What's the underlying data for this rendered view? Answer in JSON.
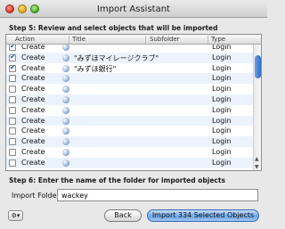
{
  "window": {
    "title": "Import Assistant"
  },
  "step5": {
    "label": "Step 5: Review and select objects that will be imported"
  },
  "table": {
    "columns": {
      "action": "Action",
      "title": "Title",
      "subfolder": "Subfolder",
      "type": "Type"
    },
    "rows": [
      {
        "checked": true,
        "action": "Create",
        "title": "",
        "type": "Login"
      },
      {
        "checked": true,
        "action": "Create",
        "title": "\"みずほマイレージクラブ\"",
        "type": "Login"
      },
      {
        "checked": true,
        "action": "Create",
        "title": "\"みずほ銀行\"",
        "type": "Login"
      },
      {
        "checked": false,
        "action": "Create",
        "title": "",
        "type": "Login"
      },
      {
        "checked": false,
        "action": "Create",
        "title": "",
        "type": "Login"
      },
      {
        "checked": false,
        "action": "Create",
        "title": "",
        "type": "Login"
      },
      {
        "checked": false,
        "action": "Create",
        "title": "",
        "type": "Login"
      },
      {
        "checked": false,
        "action": "Create",
        "title": "",
        "type": "Login"
      },
      {
        "checked": false,
        "action": "Create",
        "title": "",
        "type": "Login"
      },
      {
        "checked": false,
        "action": "Create",
        "title": "",
        "type": "Login"
      },
      {
        "checked": false,
        "action": "Create",
        "title": "",
        "type": "Login"
      },
      {
        "checked": false,
        "action": "Create",
        "title": "",
        "type": "Login"
      }
    ]
  },
  "step6": {
    "label": "Step 6: Enter the name of the folder for imported objects"
  },
  "folder": {
    "label": "Import Folder:",
    "value": "wackey"
  },
  "buttons": {
    "gear": "gear-icon",
    "back": "Back",
    "import": "Import 334 Selected Objects"
  },
  "colors": {
    "accent": "#2e6cc4",
    "row_alt": "#edf3fe"
  }
}
